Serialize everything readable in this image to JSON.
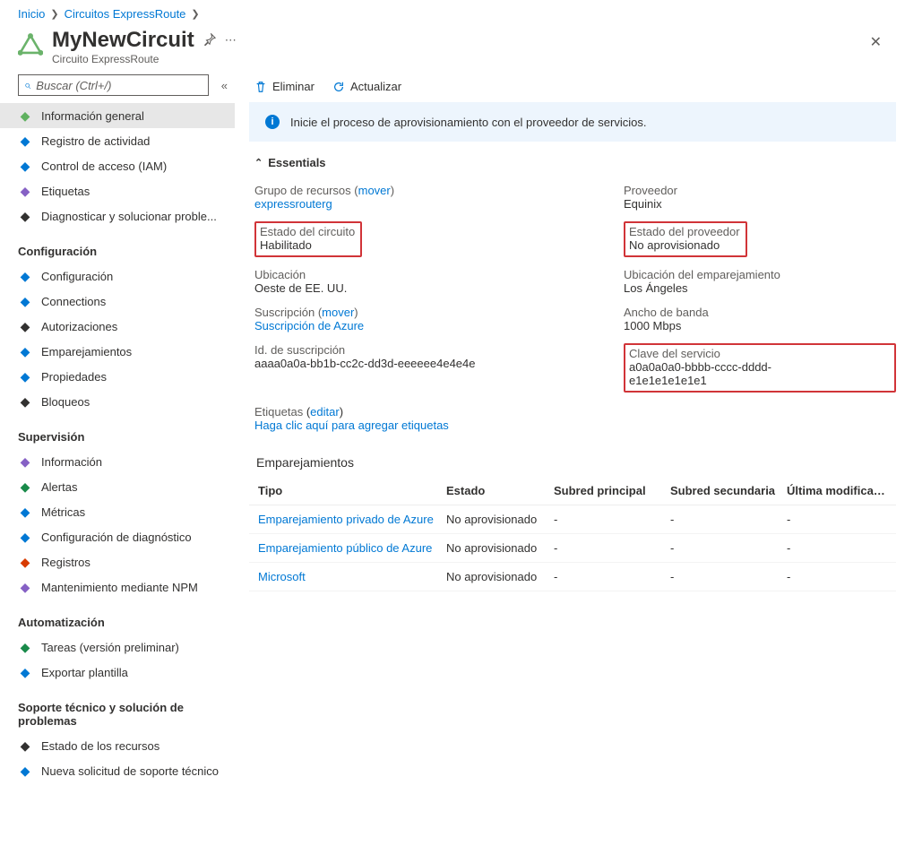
{
  "breadcrumb": {
    "home": "Inicio",
    "crumb": "Circuitos ExpressRoute"
  },
  "header": {
    "title": "MyNewCircuit",
    "subtitle": "Circuito ExpressRoute"
  },
  "search": {
    "placeholder": "Buscar (Ctrl+/)"
  },
  "sidebar": {
    "top": [
      {
        "label": "Información general",
        "color": "#5fb15f",
        "selected": true
      },
      {
        "label": "Registro de actividad",
        "color": "#0078d4"
      },
      {
        "label": "Control de acceso (IAM)",
        "color": "#0078d4"
      },
      {
        "label": "Etiquetas",
        "color": "#8661c5"
      },
      {
        "label": "Diagnosticar y solucionar proble...",
        "color": "#323130"
      }
    ],
    "sections": [
      {
        "title": "Configuración",
        "items": [
          {
            "label": "Configuración",
            "color": "#0078d4"
          },
          {
            "label": "Connections",
            "color": "#0078d4"
          },
          {
            "label": "Autorizaciones",
            "color": "#323130"
          },
          {
            "label": "Emparejamientos",
            "color": "#0078d4"
          },
          {
            "label": "Propiedades",
            "color": "#0078d4"
          },
          {
            "label": "Bloqueos",
            "color": "#323130"
          }
        ]
      },
      {
        "title": "Supervisión",
        "items": [
          {
            "label": "Información",
            "color": "#8661c5"
          },
          {
            "label": "Alertas",
            "color": "#198a4a"
          },
          {
            "label": "Métricas",
            "color": "#0078d4"
          },
          {
            "label": "Configuración de diagnóstico",
            "color": "#0078d4"
          },
          {
            "label": "Registros",
            "color": "#d83b01"
          },
          {
            "label": "Mantenimiento mediante NPM",
            "color": "#8661c5"
          }
        ]
      },
      {
        "title": "Automatización",
        "items": [
          {
            "label": "Tareas (versión preliminar)",
            "color": "#198a4a"
          },
          {
            "label": "Exportar plantilla",
            "color": "#0078d4"
          }
        ]
      },
      {
        "title": "Soporte técnico y solución de problemas",
        "items": [
          {
            "label": "Estado de los recursos",
            "color": "#323130"
          },
          {
            "label": "Nueva solicitud de soporte técnico",
            "color": "#0078d4"
          }
        ]
      }
    ]
  },
  "toolbar": {
    "delete": "Eliminar",
    "refresh": "Actualizar"
  },
  "banner": {
    "text": "Inicie el proceso de aprovisionamiento con el proveedor de servicios."
  },
  "essentials": {
    "label": "Essentials",
    "left": {
      "resource_group_k": "Grupo de recursos",
      "move1": "mover",
      "resource_group_v": "expressrouterg",
      "circuit_state_k": "Estado del circuito",
      "circuit_state_v": "Habilitado",
      "location_k": "Ubicación",
      "location_v": "Oeste de EE. UU.",
      "subscription_k": "Suscripción",
      "move2": "mover",
      "subscription_v": "Suscripción de Azure",
      "sub_id_k": "Id. de suscripción",
      "sub_id_v": "aaaa0a0a-bb1b-cc2c-dd3d-eeeeee4e4e4e"
    },
    "right": {
      "provider_k": "Proveedor",
      "provider_v": "Equinix",
      "provider_state_k": "Estado del proveedor",
      "provider_state_v": "No aprovisionado",
      "peer_loc_k": "Ubicación del emparejamiento",
      "peer_loc_v": "Los Ángeles",
      "bandwidth_k": "Ancho de banda",
      "bandwidth_v": "1000 Mbps",
      "service_key_k": "Clave del servicio",
      "service_key_v": "a0a0a0a0-bbbb-cccc-dddd-e1e1e1e1e1e1"
    },
    "tags_k": "Etiquetas",
    "tags_edit": "editar",
    "tags_add": "Haga clic aquí para agregar etiquetas"
  },
  "peerings": {
    "title": "Emparejamientos",
    "headers": {
      "type": "Tipo",
      "state": "Estado",
      "primary": "Subred principal",
      "secondary": "Subred secundaria",
      "last": "Última modificaci..."
    },
    "rows": [
      {
        "type": "Emparejamiento privado de Azure",
        "state": "No aprovisionado",
        "p": "-",
        "s": "-",
        "l": "-"
      },
      {
        "type": "Emparejamiento público de Azure",
        "state": "No aprovisionado",
        "p": "-",
        "s": "-",
        "l": "-"
      },
      {
        "type": "Microsoft",
        "state": "No aprovisionado",
        "p": "-",
        "s": "-",
        "l": "-"
      }
    ]
  }
}
